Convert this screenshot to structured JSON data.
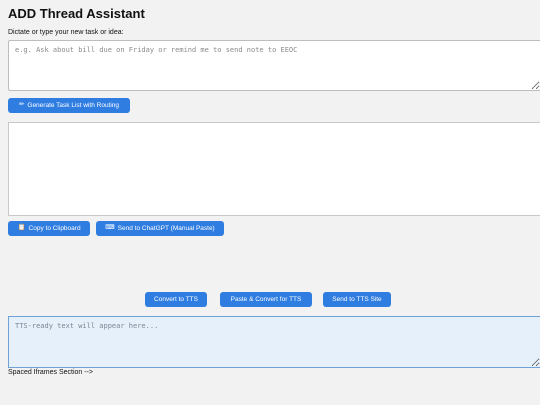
{
  "app": {
    "title": "ADD Thread Assistant"
  },
  "task_entry": {
    "label": "Dictate or type your new task or idea:",
    "placeholder": "e.g. Ask about bill due on Friday or remind me to send note to EEOC",
    "value": ""
  },
  "generate_button": {
    "icon": "pencil-icon",
    "glyph": "✏",
    "label": "Generate Task List with Routing"
  },
  "output": {
    "value": ""
  },
  "actions": {
    "copy": {
      "icon": "clipboard-icon",
      "glyph": "📋",
      "label": "Copy to Clipboard"
    },
    "chatgpt": {
      "icon": "keyboard-icon",
      "glyph": "⌨",
      "label": "Send to ChatGPT (Manual Paste)"
    }
  },
  "tts": {
    "convert_label": "Convert to TTS",
    "paste_convert_label": "Paste & Convert for TTS",
    "send_site_label": "Send to TTS Site",
    "placeholder": "TTS-ready text will appear here...",
    "value": ""
  },
  "footer": {
    "note": "Spaced Iframes Section -->"
  },
  "colors": {
    "accent": "#2f7de1",
    "tts_background": "#e6f0fb",
    "tts_border": "#6fa3d6",
    "page_background": "#f2f2f2"
  }
}
